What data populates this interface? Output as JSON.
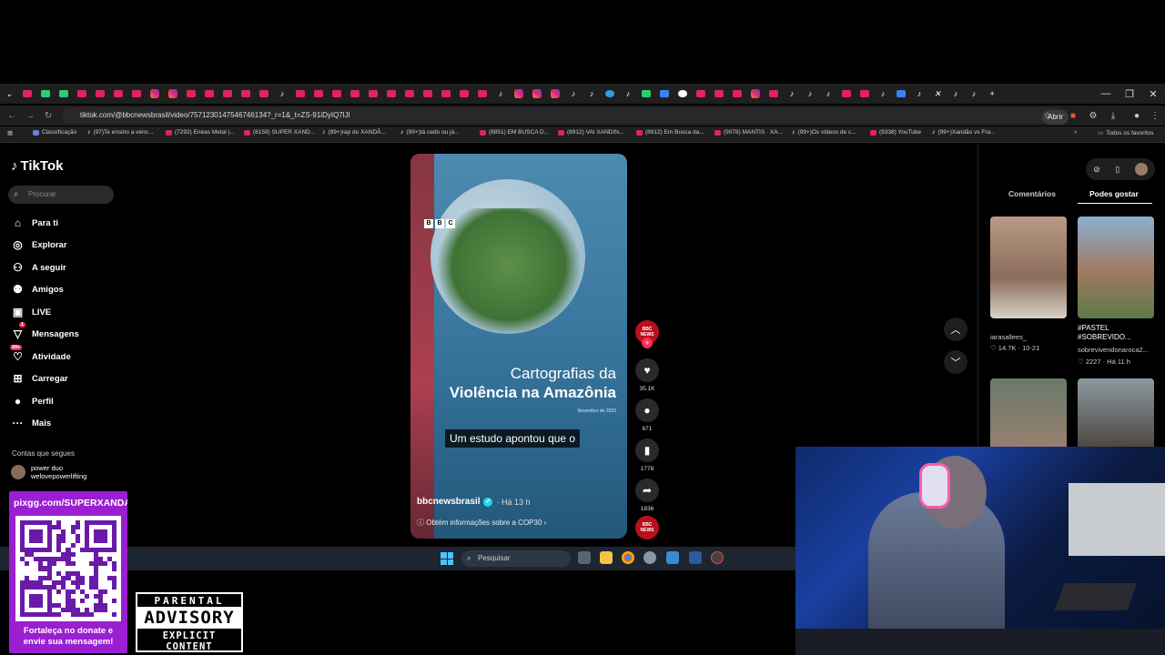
{
  "browser": {
    "url": "tiktok.com/@bbcnewsbrasil/video/7571230147546746134?_r=1&_t=ZS-91iDyIQ7lJl",
    "open_app": "Abrir no app",
    "bookmarks": [
      "Classificação",
      "(97)Te ensino a venc...",
      "(7292) Enéas Metal |...",
      "(8159) SUPER XAND...",
      "(99+)rap do XANDÃ...",
      "(99+)tá cedo ou já...",
      "(8851) EM BUSCA D...",
      "(8912) VAI XANDIN...",
      "(8912) Em Busca da...",
      "(9078) MANTIS · XA...",
      "(99+)Os vídeos de c...",
      "(9338) YouTube",
      "(99+)Xandão vs Fra..."
    ],
    "all_favorites": "Todos os favoritos"
  },
  "tiktok": {
    "logo": "TikTok",
    "search_placeholder": "Procurar",
    "nav": [
      {
        "label": "Para ti",
        "icon": "home-icon"
      },
      {
        "label": "Explorar",
        "icon": "compass-icon"
      },
      {
        "label": "A seguir",
        "icon": "following-icon"
      },
      {
        "label": "Amigos",
        "icon": "friends-icon"
      },
      {
        "label": "LIVE",
        "icon": "live-icon"
      },
      {
        "label": "Mensagens",
        "icon": "messages-icon",
        "badge": "1"
      },
      {
        "label": "Atividade",
        "icon": "activity-icon",
        "badge": "99+"
      },
      {
        "label": "Carregar",
        "icon": "upload-icon"
      },
      {
        "label": "Perfil",
        "icon": "profile-icon"
      },
      {
        "label": "Mais",
        "icon": "more-icon"
      }
    ],
    "following_title": "Contas que segues",
    "following_user": {
      "name": "power duo",
      "handle": "welovepowerlifting"
    },
    "video": {
      "bbc": [
        "B",
        "B",
        "C"
      ],
      "title_line1": "Cartografias da",
      "title_line2": "Violência na Amazônia",
      "date": "Novembro de 2023",
      "subtitle": "Um estudo apontou que o",
      "author": "bbcnewsbrasil",
      "time": "· Há 13 h",
      "info": "Obtém informações sobre a COP30"
    },
    "actions": {
      "likes": "35.1K",
      "comments": "671",
      "saves": "1778",
      "shares": "1836",
      "news_label": "BBC NEWS"
    },
    "right_panel": {
      "tab_comments": "Comentários",
      "tab_suggested": "Podes gostar",
      "thumbs": [
        {
          "title": "",
          "author": "iarasallees_",
          "stats": "♡ 14.7K · 10-21"
        },
        {
          "title": "#PASTEL #SOBREVIDO...",
          "author": "sobrevivendonaroca2...",
          "stats": "♡ 2227 · Há 11 h"
        },
        {
          "title": "",
          "author": "",
          "stats": ""
        },
        {
          "title": "",
          "author": "",
          "stats": ""
        }
      ]
    }
  },
  "taskbar": {
    "search_placeholder": "Pesquisar"
  },
  "overlay": {
    "donate_url": "pixgg.com/SUPERXANDAO",
    "donate_msg": "Fortaleça no donate e envie sua mensagem!",
    "advisory_line1": "PARENTAL",
    "advisory_line2": "ADVISORY",
    "advisory_line3": "EXPLICIT CONTENT"
  },
  "colors": {
    "accent": "#fe2c55",
    "donate_bg": "#9a1fd0",
    "bbc_red": "#b8101e"
  }
}
